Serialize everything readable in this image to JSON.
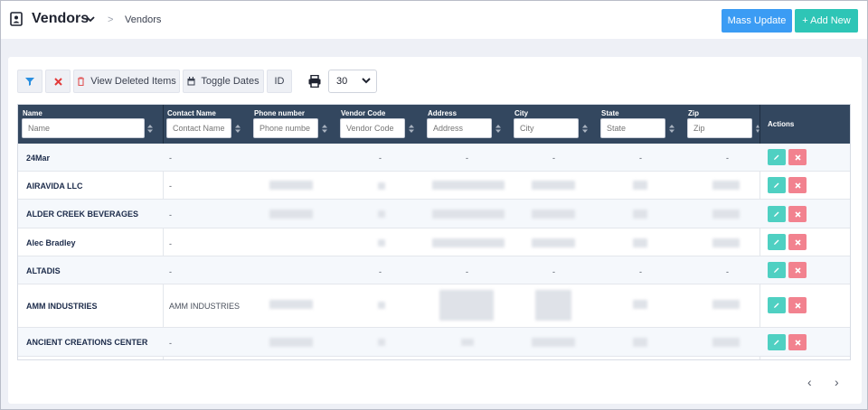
{
  "header": {
    "title": "Vendors",
    "breadcrumb_sep": ">",
    "breadcrumb": "Vendors",
    "mass_update_label": "Mass Update",
    "add_new_label": "Add New"
  },
  "toolbar": {
    "view_deleted_label": "View Deleted Items",
    "toggle_dates_label": "Toggle Dates",
    "id_label": "ID",
    "page_size": "30"
  },
  "table": {
    "columns": {
      "name": {
        "label": "Name",
        "placeholder": "Name"
      },
      "contact": {
        "label": "Contact Name",
        "placeholder": "Contact Name"
      },
      "phone": {
        "label": "Phone number",
        "placeholder": "Phone numbe"
      },
      "vendor_code": {
        "label": "Vendor Code",
        "placeholder": "Vendor Code"
      },
      "address": {
        "label": "Address",
        "placeholder": "Address"
      },
      "city": {
        "label": "City",
        "placeholder": "City"
      },
      "state": {
        "label": "State",
        "placeholder": "State"
      },
      "zip": {
        "label": "Zip",
        "placeholder": "Zip"
      },
      "actions": {
        "label": "Actions"
      }
    },
    "rows": [
      {
        "name": "24Mar",
        "contact": "-",
        "phone": "",
        "vendor_code": "-",
        "address": "-",
        "city": "-",
        "state": "-",
        "zip": "-"
      },
      {
        "name": "AIRAVIDA LLC",
        "contact": "-",
        "phone": "",
        "vendor_code": "",
        "address": "",
        "city": "",
        "state": "",
        "zip": ""
      },
      {
        "name": "ALDER CREEK BEVERAGES",
        "contact": "-",
        "phone": "",
        "vendor_code": "",
        "address": "",
        "city": "",
        "state": "",
        "zip": ""
      },
      {
        "name": "Alec Bradley",
        "contact": "-",
        "phone": "",
        "vendor_code": "",
        "address": "",
        "city": "",
        "state": "",
        "zip": ""
      },
      {
        "name": "ALTADIS",
        "contact": "-",
        "phone": "",
        "vendor_code": "-",
        "address": "-",
        "city": "-",
        "state": "-",
        "zip": "-"
      },
      {
        "name": "AMM INDUSTRIES",
        "contact": "AMM INDUSTRIES",
        "phone": "",
        "vendor_code": "",
        "address": "",
        "city": "",
        "state": "",
        "zip": ""
      },
      {
        "name": "ANCIENT CREATIONS CENTER",
        "contact": "-",
        "phone": "",
        "vendor_code": "",
        "address": "",
        "city": "",
        "state": "",
        "zip": ""
      }
    ]
  },
  "pager": {
    "prev": "‹",
    "next": "›"
  },
  "colors": {
    "header_bg": "#33475f",
    "mass_update": "#3b9cf4",
    "add_new": "#2ec5b6",
    "edit": "#4fd0c2",
    "delete": "#f2828f"
  },
  "icons": [
    "contact-card-icon",
    "chevron-down-icon",
    "filter-icon",
    "clear-filter-icon",
    "trash-icon",
    "calendar-icon",
    "print-icon",
    "sort-icon",
    "pencil-icon",
    "times-icon",
    "plus-icon"
  ]
}
